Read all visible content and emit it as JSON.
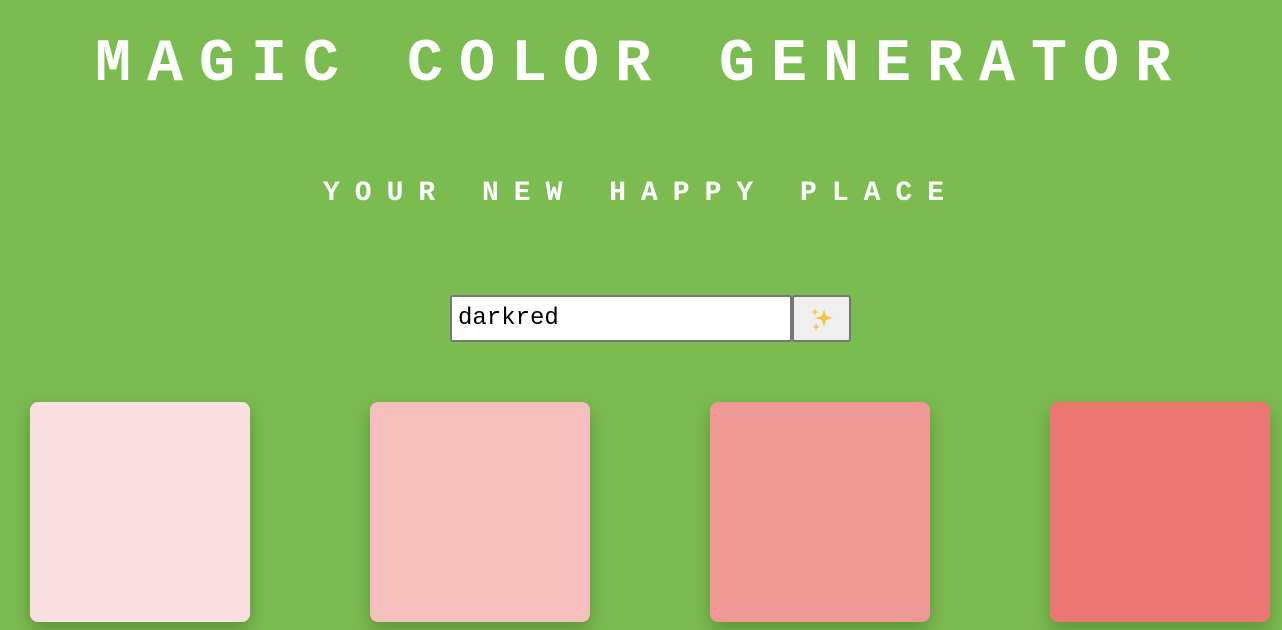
{
  "header": {
    "title": "MAGIC COLOR GENERATOR",
    "subtitle": "YOUR NEW HAPPY PLACE"
  },
  "form": {
    "input_value": "darkred",
    "button_icon": "sparkles-icon"
  },
  "colors": {
    "background": "#7bbc51",
    "text": "#ffffff",
    "sparkle": "#f5c542"
  },
  "swatches": [
    {
      "color": "#fbe0e1"
    },
    {
      "color": "#f4bfbd"
    },
    {
      "color": "#ee9996"
    },
    {
      "color": "#ec7772"
    }
  ]
}
